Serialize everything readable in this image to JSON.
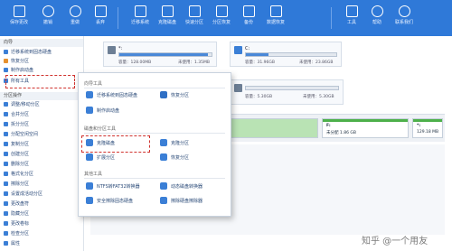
{
  "colors": {
    "toolbar": "#2f79d8",
    "highlight": "#d0332f",
    "accent": "#3b7fd6",
    "partition_fill": "#4db04a"
  },
  "toolbar": {
    "buttons": [
      {
        "label": "保存更改",
        "icon": "save-icon"
      },
      {
        "label": "撤销",
        "icon": "undo-icon"
      },
      {
        "label": "重做",
        "icon": "redo-icon"
      },
      {
        "label": "丢弃",
        "icon": "discard-icon"
      },
      {
        "label": "迁移系统",
        "icon": "migrate-icon"
      },
      {
        "label": "克隆磁盘",
        "icon": "clone-disk-icon"
      },
      {
        "label": "快速分区",
        "icon": "quick-partition-icon"
      },
      {
        "label": "分区恢复",
        "icon": "partition-recovery-icon"
      },
      {
        "label": "备份",
        "icon": "backup-icon"
      },
      {
        "label": "数据恢复",
        "icon": "data-recovery-icon"
      },
      {
        "label": "工具",
        "icon": "tools-icon"
      },
      {
        "label": "帮助",
        "icon": "help-icon"
      },
      {
        "label": "联系我们",
        "icon": "contact-icon"
      }
    ]
  },
  "sidebar": {
    "section_ops": "向导",
    "items_top": [
      {
        "label": "迁移系统到固态硬盘",
        "icon": "migrate-icon"
      },
      {
        "label": "恢复分区",
        "icon": "recover-icon"
      },
      {
        "label": "制作启动盘",
        "icon": "boot-disk-icon"
      },
      {
        "label": "所有工具",
        "icon": "all-tools-icon"
      }
    ],
    "section_part": "分区操作",
    "items_part": [
      {
        "label": "调整/移动分区",
        "icon": "resize-icon"
      },
      {
        "label": "合并分区",
        "icon": "merge-icon"
      },
      {
        "label": "拆分分区",
        "icon": "split-icon"
      },
      {
        "label": "分配空闲空间",
        "icon": "allocate-icon"
      },
      {
        "label": "复制分区",
        "icon": "copy-icon"
      },
      {
        "label": "创建分区",
        "icon": "create-icon"
      },
      {
        "label": "删除分区",
        "icon": "delete-icon"
      },
      {
        "label": "格式化分区",
        "icon": "format-icon"
      },
      {
        "label": "擦除分区",
        "icon": "wipe-icon"
      },
      {
        "label": "设置成活动分区",
        "icon": "active-icon"
      },
      {
        "label": "更改盘符",
        "icon": "letter-icon"
      },
      {
        "label": "隐藏分区",
        "icon": "hide-icon"
      },
      {
        "label": "更改卷标",
        "icon": "label-icon"
      },
      {
        "label": "检查分区",
        "icon": "check-icon"
      },
      {
        "label": "属性",
        "icon": "properties-icon"
      }
    ]
  },
  "disks": [
    {
      "name": "*:",
      "size": "容量：128.00MB",
      "free": "未使用：1.35MB"
    },
    {
      "name": "C:",
      "size": "容量：31.96GB",
      "free": "未使用：23.86GB"
    }
  ],
  "disk2_size": "容量：5.30GB",
  "disk2_free": "未使用：5.30GB",
  "partitions": [
    {
      "label": "F:",
      "detail": "未分配 1.86 GB"
    },
    {
      "label": "*:",
      "detail": "129.18 MB"
    }
  ],
  "popup": {
    "section_common": "向导工具",
    "item_migrate": "迁移系统到固态硬盘",
    "item_recover": "恢复分区",
    "item_boot": "制作启动盘",
    "item_file": "删除文件",
    "section_disk": "磁盘和分区工具",
    "item_clone_disk": "克隆磁盘",
    "item_clone_part": "克隆分区",
    "item_expand": "扩展分区",
    "item_rescue": "恢复分区",
    "section_other": "其他工具",
    "item_ntfs": "NTFS转FAT32转换器",
    "item_dyn": "动态磁盘转换器",
    "item_safe": "安全擦除固态硬盘",
    "item_wipe": "擦除硬盘擦除器"
  },
  "watermark": "知乎 @一个用友"
}
